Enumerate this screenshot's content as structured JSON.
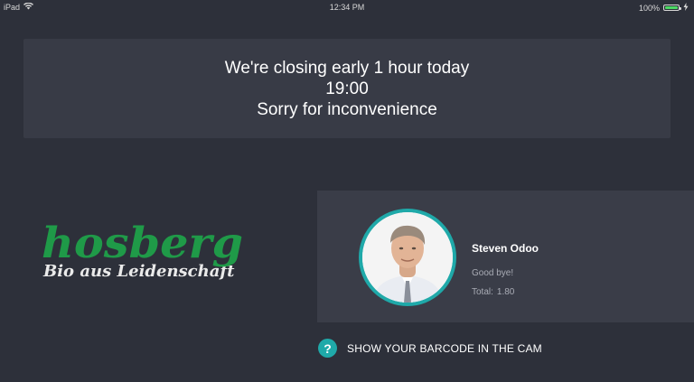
{
  "status_bar": {
    "device": "iPad",
    "wifi_icon": "wifi-icon",
    "time": "12:34 PM",
    "battery_percent": "100%",
    "battery_level": 1.0,
    "charging_icon": "bolt-icon"
  },
  "announcement": {
    "line1": "We're closing early 1 hour today",
    "line2": "19:00",
    "line3": "Sorry for inconvenience"
  },
  "logo": {
    "word": "hosberg",
    "tagline": "Bio aus Leidenschaft",
    "color": "#1f9a48"
  },
  "customer": {
    "name": "Steven Odoo",
    "message": "Good bye!",
    "total_label": "Total:",
    "total_value": "1.80",
    "avatar_ring_color": "#1fa9a9"
  },
  "help": {
    "icon": "question-icon",
    "icon_glyph": "?",
    "text": "SHOW YOUR BARCODE IN THE CAM"
  },
  "colors": {
    "background": "#2d303a",
    "panel": "#383b46",
    "accent": "#1fa9a9"
  }
}
